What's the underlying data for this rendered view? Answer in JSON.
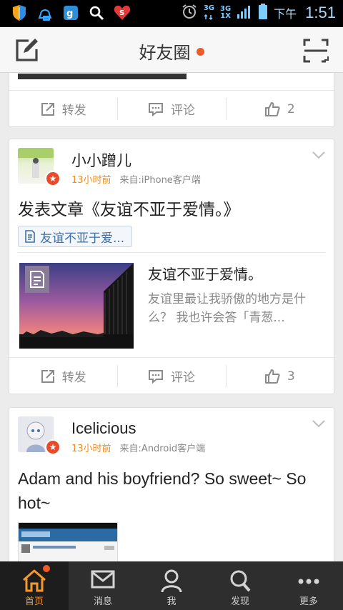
{
  "status_bar": {
    "network_1": "3G",
    "network_2": "3G",
    "network_2_sub": "1X",
    "time_prefix": "下午",
    "time": "1:51"
  },
  "header": {
    "title": "好友圈",
    "compose_icon": "compose-icon",
    "scan_icon": "scan-icon",
    "accent": "#f05a2a"
  },
  "feed": {
    "top_card": {
      "actions": {
        "repost_label": "转发",
        "comment_label": "评论",
        "like_count": "2"
      }
    },
    "posts": [
      {
        "username": "小小蹭儿",
        "time": "13小时前",
        "source": "来自:iPhone客户端",
        "text": "发表文章《友谊不亚于爱情。》",
        "link_tag": "友谊不亚于爱...",
        "article": {
          "title": "友谊不亚于爱情。",
          "desc": "友谊里最让我骄傲的地方是什么？ 我也许会答「青葱..."
        },
        "actions": {
          "repost_label": "转发",
          "comment_label": "评论",
          "like_count": "3"
        }
      },
      {
        "username": "Icelicious",
        "time": "13小时前",
        "source": "来自:Android客户端",
        "text": "Adam and his boyfriend? So sweet~ So hot~"
      }
    ]
  },
  "bottom_nav": {
    "items": [
      {
        "label": "首页",
        "icon": "home-icon",
        "active": true
      },
      {
        "label": "消息",
        "icon": "mail-icon"
      },
      {
        "label": "我",
        "icon": "person-icon"
      },
      {
        "label": "发现",
        "icon": "search-icon"
      },
      {
        "label": "更多",
        "icon": "more-icon"
      }
    ],
    "active_color": "#f49a2d"
  }
}
